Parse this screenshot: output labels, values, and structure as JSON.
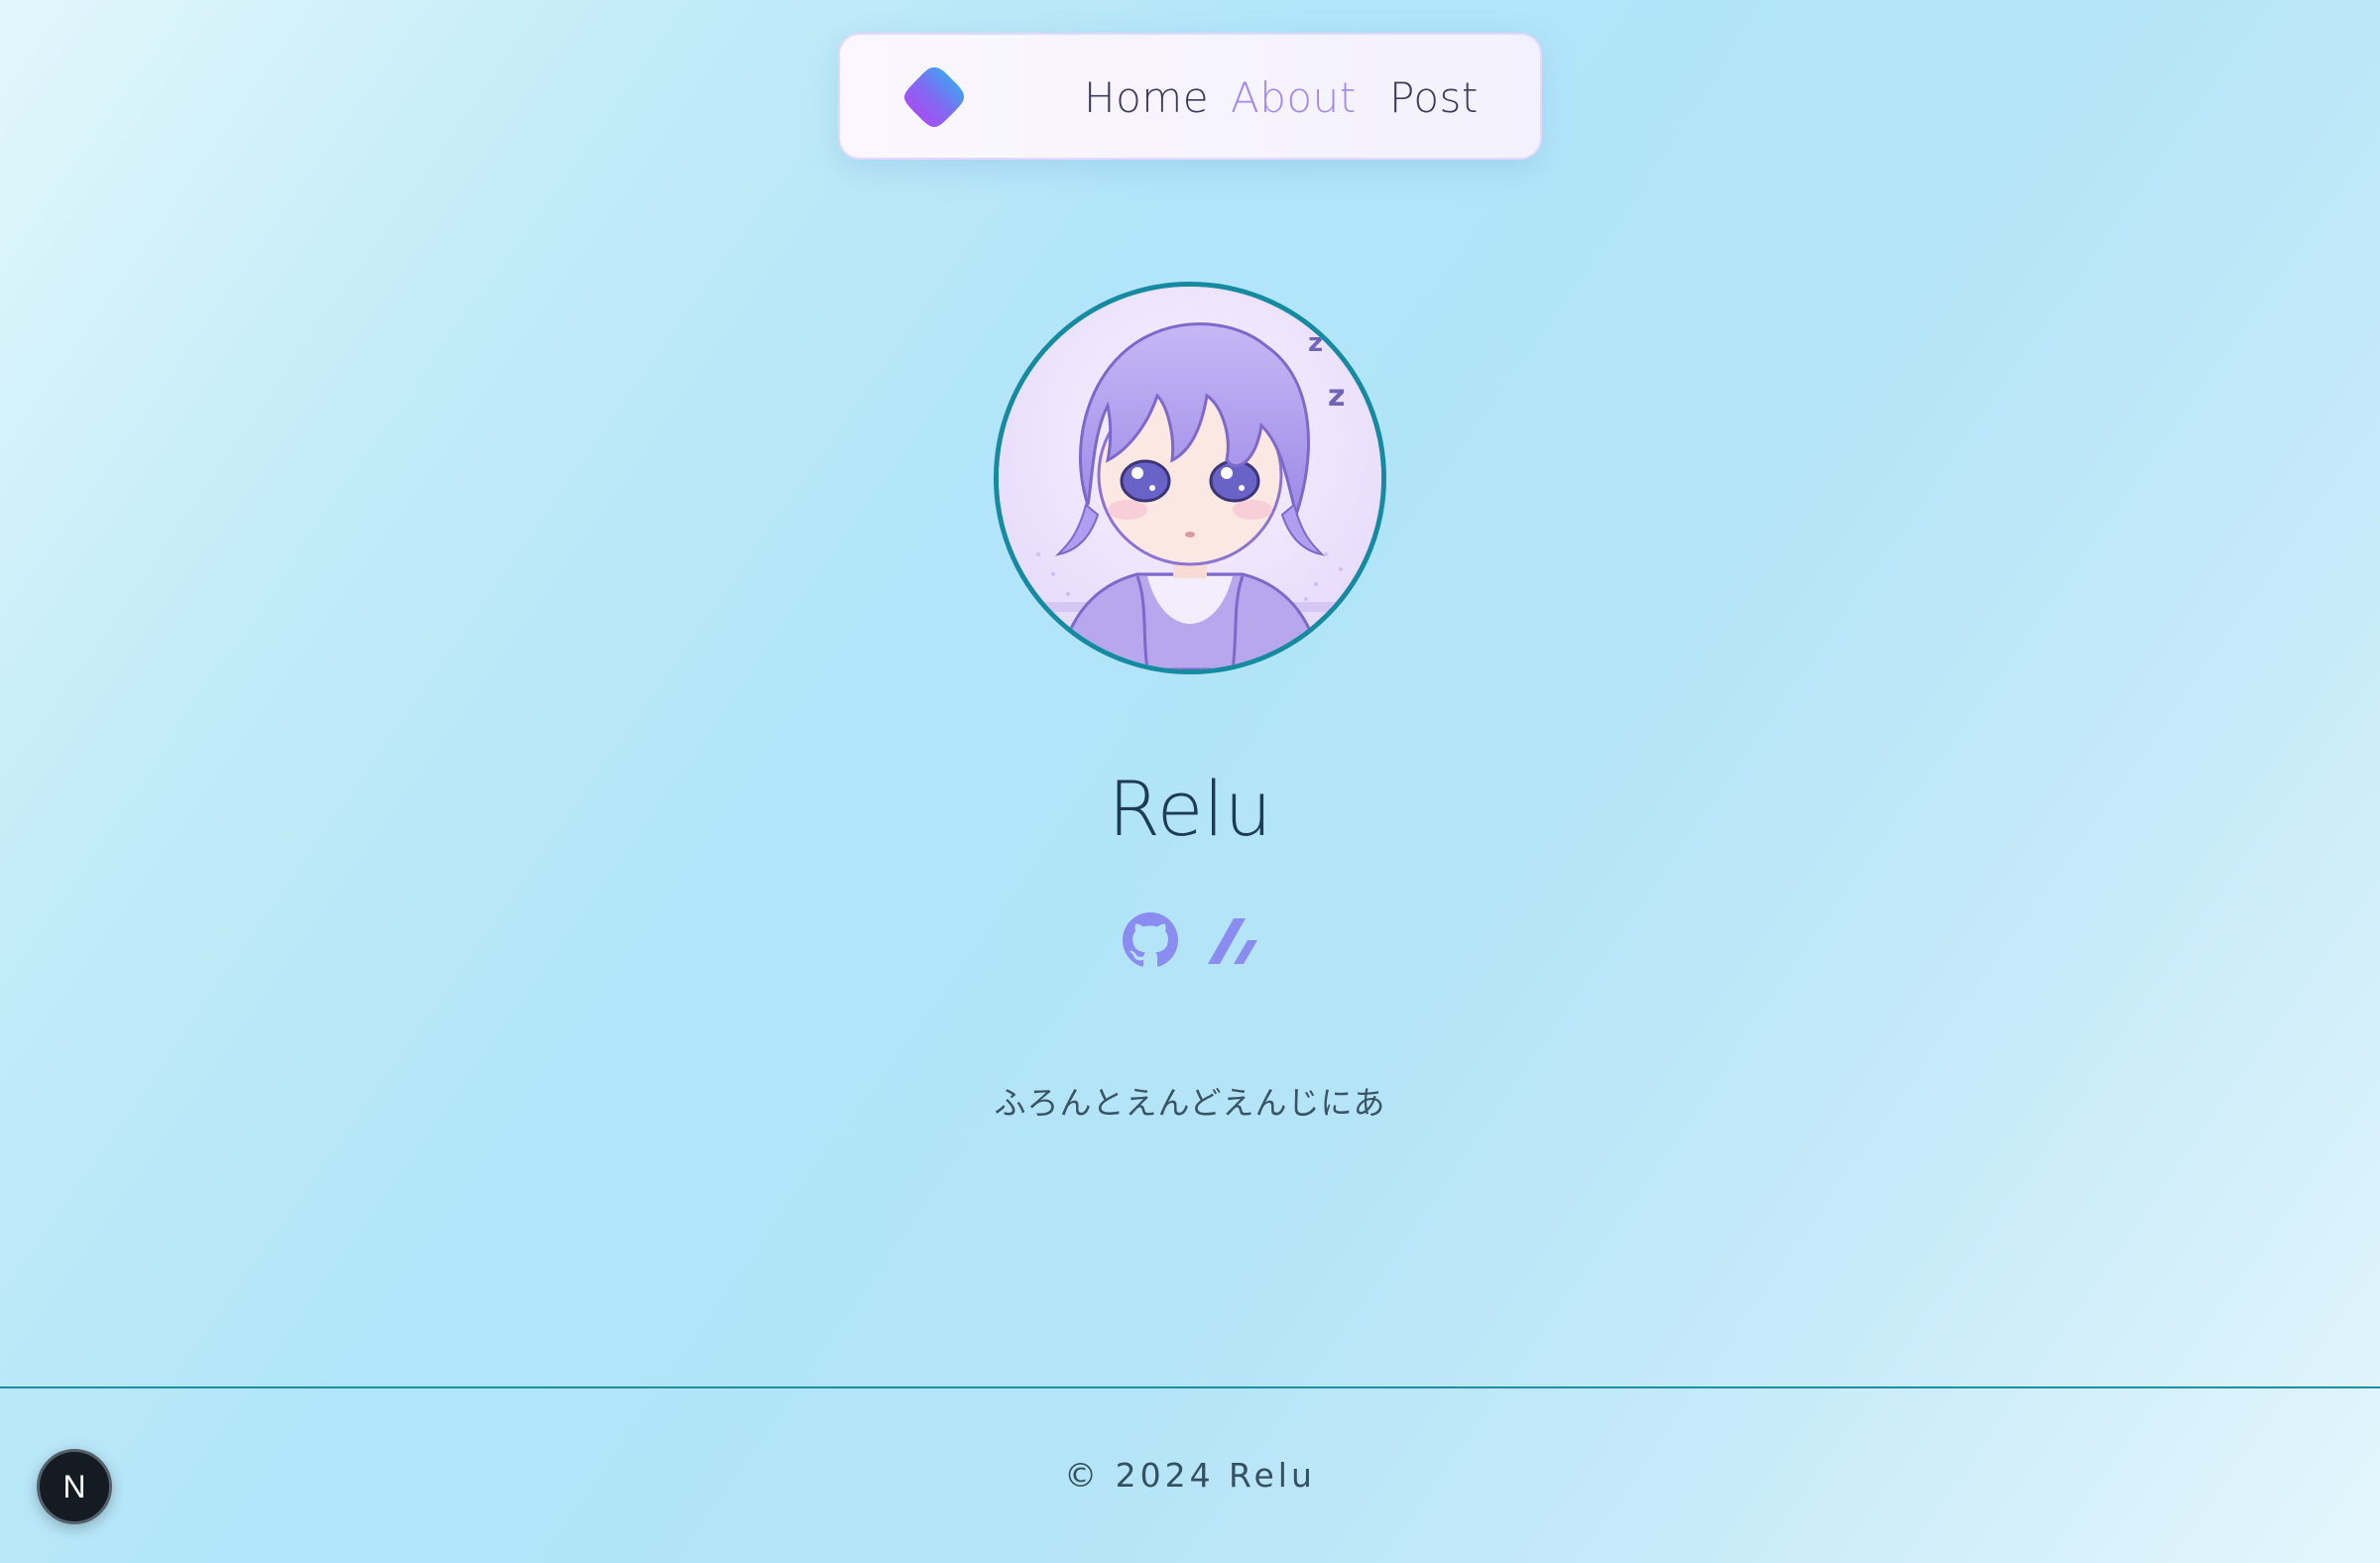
{
  "nav": {
    "logo_icon": "gradient-blob-logo-icon",
    "links": [
      {
        "label": "Home",
        "active": false
      },
      {
        "label": "About",
        "active": true
      },
      {
        "label": "Post",
        "active": false
      }
    ]
  },
  "profile": {
    "avatar_icon": "chibi-avatar-illustration",
    "name": "Relu",
    "socials": [
      {
        "icon": "github-icon"
      },
      {
        "icon": "zenn-icon"
      }
    ],
    "bio": "ふろんとえんどえんじにあ"
  },
  "footer": {
    "copyright": "© 2024 Relu"
  },
  "dev_badge": {
    "label": "N",
    "icon": "nextjs-badge-icon"
  },
  "colors": {
    "accent": "#a589ef",
    "text": "#3d3a5e",
    "divider": "#1b8ea1",
    "avatar_border": "#168aa0",
    "icon": "#8b8cf0"
  }
}
